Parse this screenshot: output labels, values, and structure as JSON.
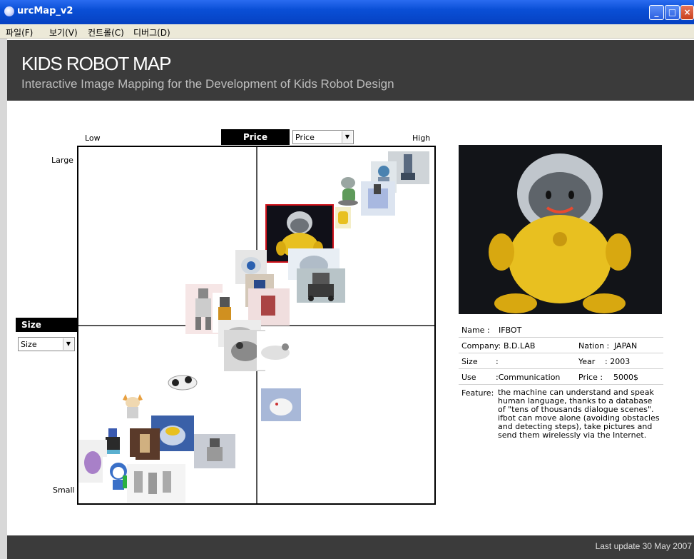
{
  "window": {
    "title": "urcMap_v2"
  },
  "menu": [
    "파일(F)",
    "보기(V)",
    "컨트롤(C)",
    "디버그(D)"
  ],
  "header": {
    "title": "KIDS ROBOT MAP",
    "subtitle": "Interactive Image Mapping for the Development of Kids Robot Design"
  },
  "map": {
    "x_axis": {
      "name": "Price",
      "low_label": "Low",
      "high_label": "High",
      "select_value": "Price"
    },
    "y_axis": {
      "name": "Size",
      "high_label": "Large",
      "low_label": "Small",
      "select_value": "Size"
    },
    "selected_robot": "IFBOT"
  },
  "detail": {
    "name_label": "Name :",
    "name_value": "IFBOT",
    "company_label": "Company:",
    "company_value": "B.D.LAB",
    "nation_label": "Nation :",
    "nation_value": "JAPAN",
    "size_label": "Size",
    "size_value": ":",
    "year_label": "Year",
    "year_value": ": 2003",
    "use_label": "Use",
    "use_value": ":Communication",
    "price_label": "Price :",
    "price_value": "5000$",
    "feature_label": "Feature:",
    "feature_value": "the machine can understand and speak human language, thanks to a database of \"tens of thousands dialogue scenes\". ifbot can move alone (avoiding obstacles and detecting steps), take pictures and send them wirelessly via the Internet."
  },
  "footer": {
    "last_update": "Last update 30 May 2007"
  },
  "colors": {
    "header_bg": "#3b3b3b",
    "selection_border": "#d0121b",
    "robot_yellow": "#e8c020"
  }
}
